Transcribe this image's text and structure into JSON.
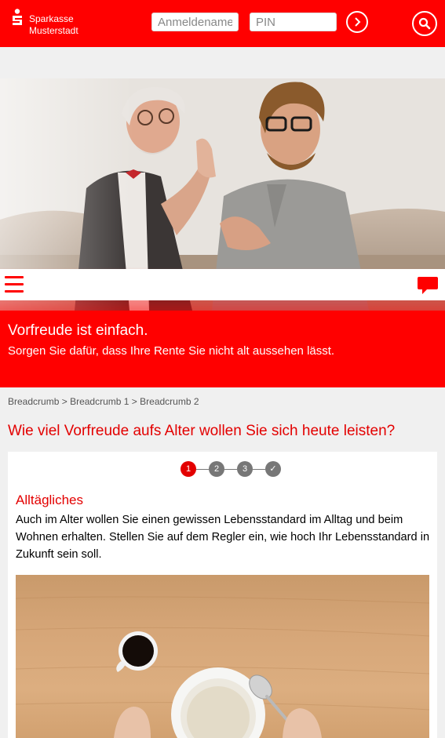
{
  "header": {
    "brand_line1": "Sparkasse",
    "brand_line2": "Musterstadt",
    "username_placeholder": "Anmeldename",
    "pin_placeholder": "PIN"
  },
  "banner": {
    "title": "Vorfreude ist einfach.",
    "subtitle": "Sorgen Sie dafür, dass Ihre Rente Sie nicht alt aussehen lässt."
  },
  "breadcrumb": {
    "items": [
      "Breadcrumb",
      "Breadcrumb 1",
      "Breadcrumb 2"
    ],
    "separator": ">"
  },
  "page_title": "Wie viel Vorfreude aufs Alter wollen Sie sich heute leisten?",
  "stepper": {
    "steps": [
      "1",
      "2",
      "3",
      "✓"
    ],
    "active_index": 0
  },
  "section": {
    "title": "Alltägliches",
    "text": "Auch im Alter wollen Sie einen gewissen Lebensstandard im Alltag und beim Wohnen erhalten. Stellen Sie auf dem Regler ein, wie hoch Ihr Lebensstandard in Zukunft sein soll."
  },
  "colors": {
    "brand_red": "#ff0000",
    "title_red": "#e30000"
  }
}
